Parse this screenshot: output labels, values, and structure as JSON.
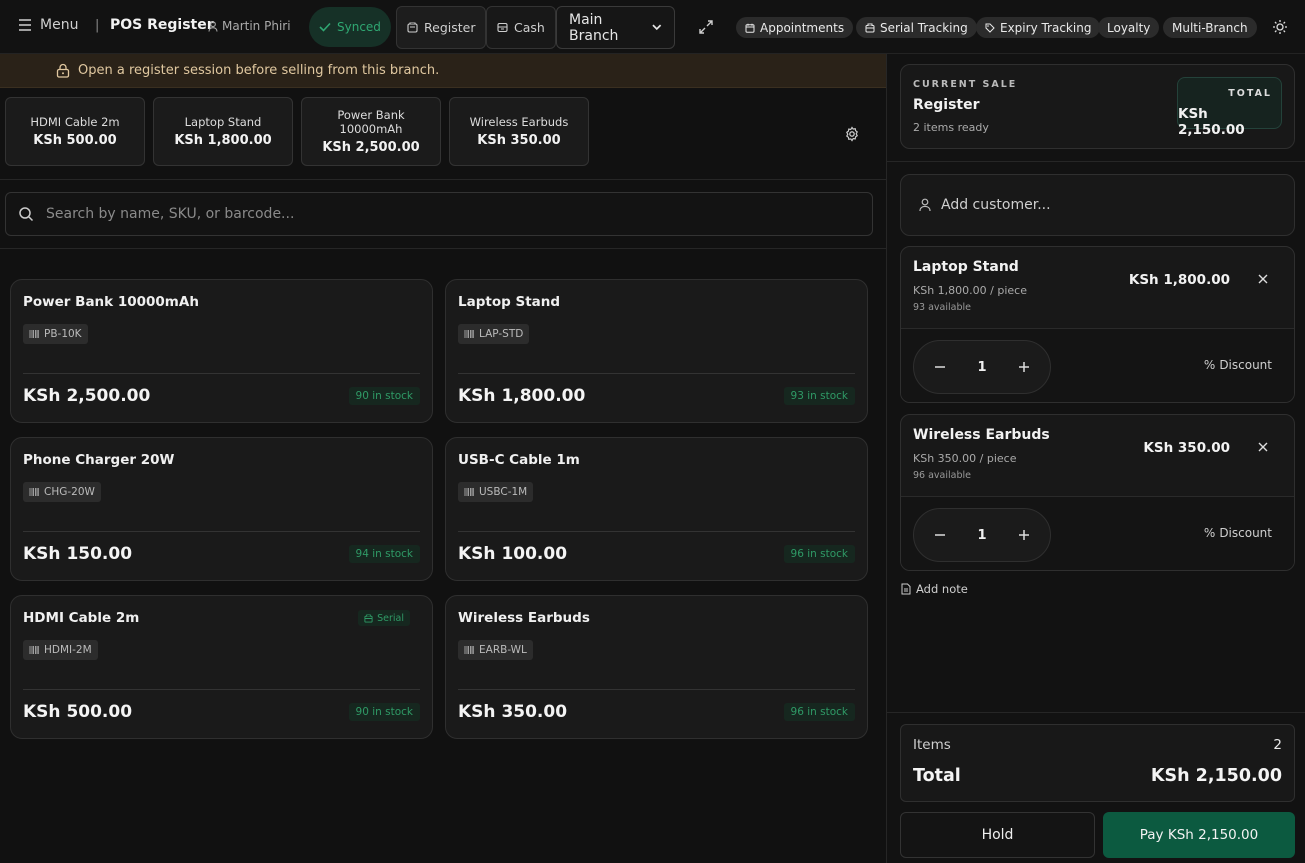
{
  "header": {
    "menu_label": "Menu",
    "separator": "|",
    "app_title": "POS Register",
    "user_name": "Martin Phiri",
    "sync_status": "Synced",
    "register_btn": "Register",
    "cash_btn": "Cash",
    "branch_selected": "Main Branch",
    "pills": [
      "Appointments",
      "Serial Tracking",
      "Expiry Tracking",
      "Loyalty",
      "Multi-Branch"
    ]
  },
  "alert": {
    "text": "Open a register session before selling from this branch."
  },
  "quick_tiles": [
    {
      "name": "HDMI Cable 2m",
      "price": "KSh 500.00"
    },
    {
      "name": "Laptop Stand",
      "price": "KSh 1,800.00"
    },
    {
      "name": "Power Bank 10000mAh",
      "price": "KSh 2,500.00"
    },
    {
      "name": "Wireless Earbuds",
      "price": "KSh 350.00"
    }
  ],
  "search": {
    "placeholder": "Search by name, SKU, or barcode..."
  },
  "products": [
    {
      "name": "Power Bank 10000mAh",
      "sku": "PB-10K",
      "price": "KSh 2,500.00",
      "stock": "90 in stock"
    },
    {
      "name": "Laptop Stand",
      "sku": "LAP-STD",
      "price": "KSh 1,800.00",
      "stock": "93 in stock"
    },
    {
      "name": "Phone Charger 20W",
      "sku": "CHG-20W",
      "price": "KSh 150.00",
      "stock": "94 in stock"
    },
    {
      "name": "USB-C Cable 1m",
      "sku": "USBC-1M",
      "price": "KSh 100.00",
      "stock": "96 in stock"
    },
    {
      "name": "HDMI Cable 2m",
      "sku": "HDMI-2M",
      "price": "KSh 500.00",
      "stock": "90 in stock",
      "badge": "Serial"
    },
    {
      "name": "Wireless Earbuds",
      "sku": "EARB-WL",
      "price": "KSh 350.00",
      "stock": "96 in stock"
    }
  ],
  "sale": {
    "kicker": "CURRENT SALE",
    "title": "Register",
    "subtitle": "2 items ready",
    "total_label": "TOTAL",
    "total_value": "KSh 2,150.00"
  },
  "customer": {
    "placeholder": "Add customer..."
  },
  "cart": [
    {
      "name": "Laptop Stand",
      "unit_price": "KSh 1,800.00 / piece",
      "available": "93 available",
      "line_total": "KSh 1,800.00",
      "qty": "1",
      "discount_label": "Discount"
    },
    {
      "name": "Wireless Earbuds",
      "unit_price": "KSh 350.00 / piece",
      "available": "96 available",
      "line_total": "KSh 350.00",
      "qty": "1",
      "discount_label": "Discount"
    }
  ],
  "add_note": "Add note",
  "summary": {
    "items_label": "Items",
    "items_value": "2",
    "total_label": "Total",
    "total_value": "KSh 2,150.00"
  },
  "actions": {
    "hold": "Hold",
    "pay": "Pay KSh 2,150.00"
  },
  "colors": {
    "accent_green": "#0c5a40",
    "stock_green": "#2f9a66",
    "alert_bg": "#2a2218"
  }
}
